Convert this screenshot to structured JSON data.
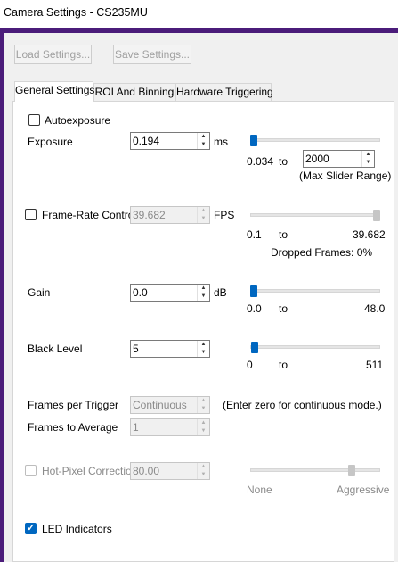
{
  "window": {
    "title": "Camera Settings - CS235MU",
    "accent_color": "#4b1c7a"
  },
  "toolbar": {
    "load_label": "Load Settings...",
    "save_label": "Save Settings..."
  },
  "tabs": [
    {
      "label": "General Settings",
      "active": true
    },
    {
      "label": "ROI And Binning",
      "active": false
    },
    {
      "label": "Hardware Triggering",
      "active": false
    }
  ],
  "general": {
    "autoexposure": {
      "label": "Autoexposure",
      "checked": false
    },
    "exposure": {
      "label": "Exposure",
      "value": "0.194",
      "unit": "ms",
      "slider_min": "0.034",
      "to": "to",
      "slider_max": "2000",
      "max_range_label": "(Max Slider Range)",
      "slider_level": 0.0
    },
    "frame_rate": {
      "label": "Frame-Rate Control",
      "checked": false,
      "value": "39.682",
      "unit": "FPS",
      "min": "0.1",
      "to": "to",
      "max": "39.682",
      "dropped": "Dropped Frames: 0%",
      "slider_level": 1.0
    },
    "gain": {
      "label": "Gain",
      "value": "0.0",
      "unit": "dB",
      "min": "0.0",
      "to": "to",
      "max": "48.0",
      "slider_level": 0.0
    },
    "black_level": {
      "label": "Black Level",
      "value": "5",
      "min": "0",
      "to": "to",
      "max": "511",
      "slider_level": 0.01
    },
    "frames_per_trigger": {
      "label": "Frames per Trigger",
      "value": "Continuous",
      "hint": "(Enter zero for continuous mode.)"
    },
    "frames_to_average": {
      "label": "Frames to Average",
      "value": "1"
    },
    "hot_pixel": {
      "label": "Hot-Pixel Correction",
      "checked": false,
      "value": "80.00",
      "min_label": "None",
      "max_label": "Aggressive",
      "slider_level": 0.8
    },
    "led": {
      "label": "LED Indicators",
      "checked": true
    }
  }
}
